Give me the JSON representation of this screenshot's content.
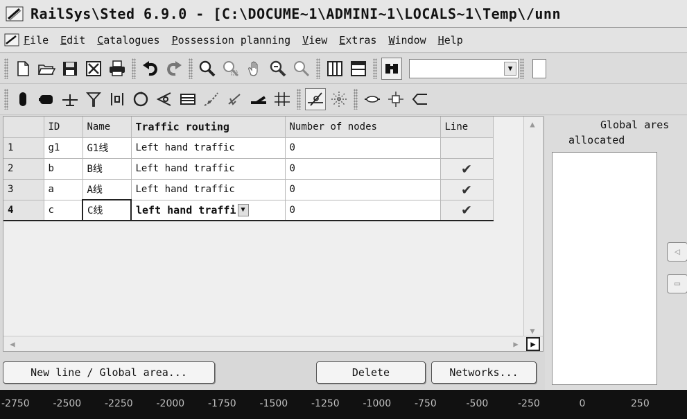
{
  "window": {
    "title": "RailSys\\Sted 6.9.0 - [C:\\DOCUME~1\\ADMINI~1\\LOCALS~1\\Temp\\/unn"
  },
  "menu": [
    "File",
    "Edit",
    "Catalogues",
    "Possession planning",
    "View",
    "Extras",
    "Window",
    "Help"
  ],
  "toolbar1": {
    "icons": [
      "new-document-icon",
      "open-folder-icon",
      "save-icon",
      "close-document-icon",
      "print-icon",
      "undo-icon",
      "redo-icon",
      "zoom-in-icon",
      "zoom-area-icon",
      "pan-hand-icon",
      "zoom-fit-icon",
      "zoom-out-icon",
      "split-view-icon",
      "window-layout-icon",
      "binoculars-icon"
    ],
    "search_value": ""
  },
  "toolbar2": {
    "icons": [
      "signal-icon",
      "switch-block-icon",
      "buffer-stop-icon",
      "filter-icon",
      "track-contact-icon",
      "loop-icon",
      "horn-icon",
      "platform-icon",
      "route-curve-icon",
      "route-arrow-icon",
      "ramp-icon",
      "crossing-icon",
      "draw-line-icon",
      "junction-star-icon",
      "level-crossing-icon",
      "node-add-icon",
      "nav-left-icon"
    ]
  },
  "table": {
    "columns": [
      "ID",
      "Name",
      "Traffic routing",
      "Number of nodes",
      "Line"
    ],
    "rows": [
      {
        "num": "1",
        "id": "g1",
        "name": "G1线",
        "routing": "Left hand traffic",
        "nodes": "0",
        "line": false
      },
      {
        "num": "2",
        "id": "b",
        "name": "B线",
        "routing": "Left hand traffic",
        "nodes": "0",
        "line": true
      },
      {
        "num": "3",
        "id": "a",
        "name": "A线",
        "routing": "Left hand traffic",
        "nodes": "0",
        "line": true
      },
      {
        "num": "4",
        "id": "c",
        "name": "C线",
        "routing": "left hand traffi",
        "nodes": "0",
        "line": true
      }
    ]
  },
  "buttons": {
    "new_line": "New line / Global area...",
    "delete": "Delete",
    "networks": "Networks..."
  },
  "right_panel": {
    "header": "Global ares",
    "subheader": "allocated"
  },
  "ruler": [
    "-2750",
    "-2500",
    "-2250",
    "-2000",
    "-1750",
    "-1500",
    "-1250",
    "-1000",
    "-750",
    "-500",
    "-250",
    "0",
    "250"
  ]
}
